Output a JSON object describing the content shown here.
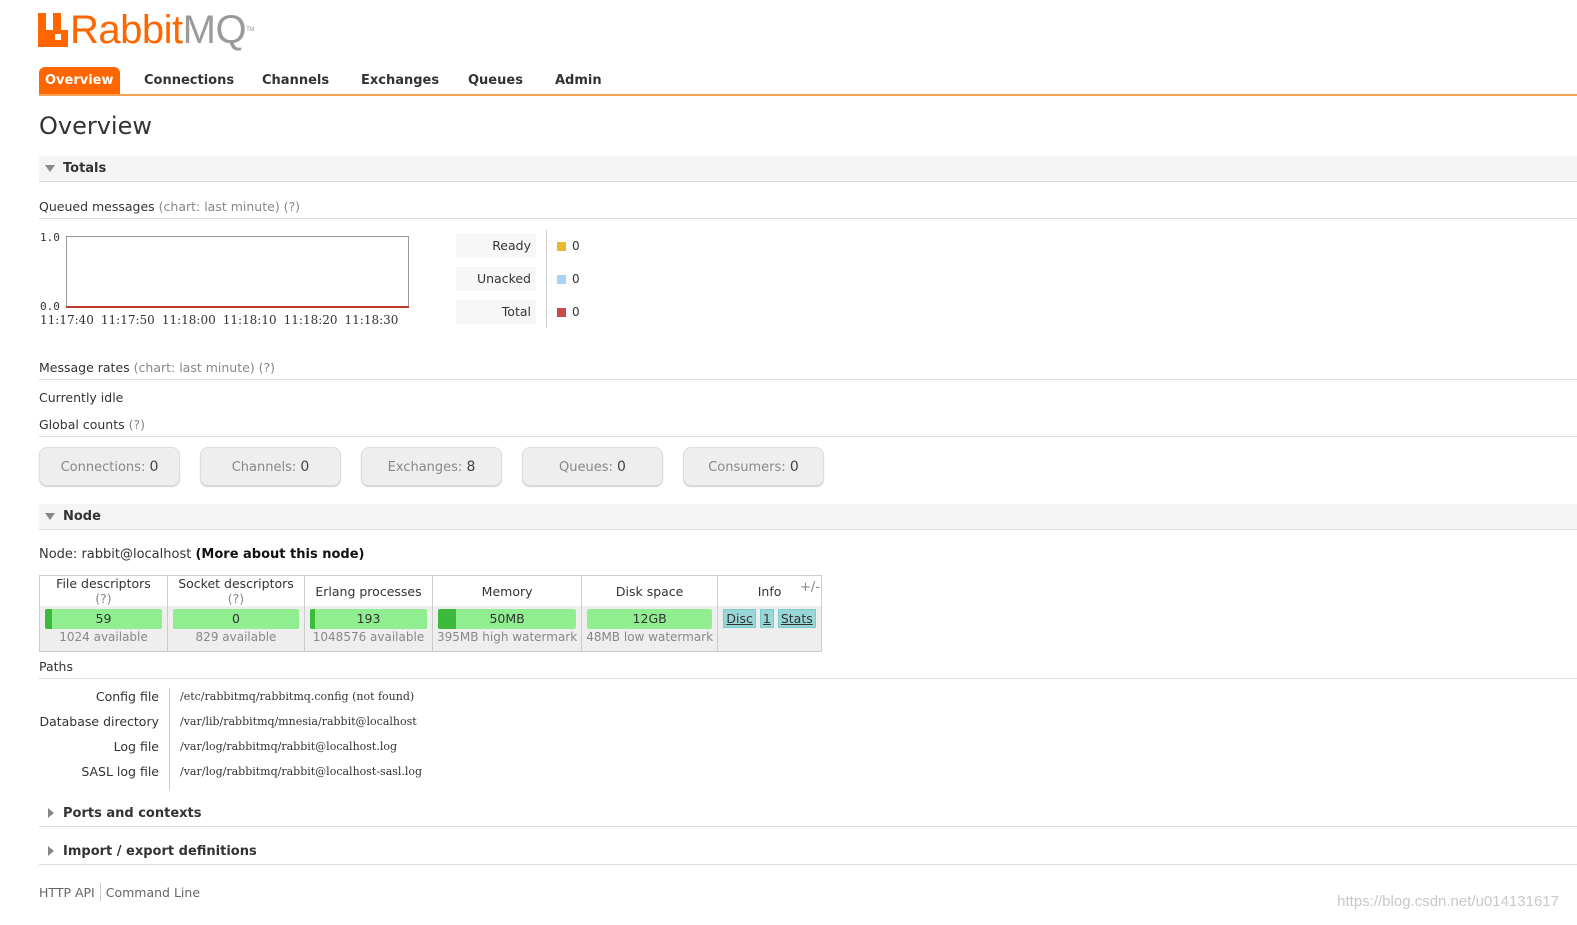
{
  "brand": {
    "rabbit": "Rabbit",
    "mq": "MQ",
    "tm": "TM"
  },
  "nav": {
    "overview": "Overview",
    "connections": "Connections",
    "channels": "Channels",
    "exchanges": "Exchanges",
    "queues": "Queues",
    "admin": "Admin"
  },
  "page_title": "Overview",
  "totals": {
    "header": "Totals",
    "queued_label": "Queued messages",
    "queued_help": "(chart: last minute) (?)",
    "y_max": "1.0",
    "y_min": "0.0",
    "x_ticks": [
      "11:17:40",
      "11:17:50",
      "11:18:00",
      "11:18:10",
      "11:18:20",
      "11:18:30"
    ],
    "legend": [
      {
        "label": "Ready",
        "value": "0",
        "color": "#e8b931"
      },
      {
        "label": "Unacked",
        "value": "0",
        "color": "#a8d3f5"
      },
      {
        "label": "Total",
        "value": "0",
        "color": "#c94a4a"
      }
    ],
    "rates_label": "Message rates",
    "rates_help": "(chart: last minute) (?)",
    "idle_text": "Currently idle",
    "global_label": "Global counts",
    "global_help": "(?)",
    "counts": {
      "connections_label": "Connections:",
      "connections_value": "0",
      "channels_label": "Channels:",
      "channels_value": "0",
      "exchanges_label": "Exchanges:",
      "exchanges_value": "8",
      "queues_label": "Queues:",
      "queues_value": "0",
      "consumers_label": "Consumers:",
      "consumers_value": "0"
    }
  },
  "node": {
    "header": "Node",
    "node_label": "Node: rabbit@localhost",
    "more_link": "(More about this node)",
    "columns": {
      "file": "File descriptors",
      "file_help": "(?)",
      "socket": "Socket descriptors",
      "socket_help": "(?)",
      "erlang": "Erlang processes",
      "memory": "Memory",
      "disk": "Disk space",
      "info": "Info"
    },
    "values": {
      "file": "59",
      "file_avail": "1024 available",
      "file_fraction": 0.058,
      "socket": "0",
      "socket_avail": "829 available",
      "socket_fraction": 0,
      "erlang": "193",
      "erlang_avail": "1048576 available",
      "erlang_fraction": 0.0002,
      "memory": "50MB",
      "memory_avail": "395MB high watermark",
      "memory_fraction": 0.127,
      "disk": "12GB",
      "disk_avail": "48MB low watermark",
      "disk_fraction": 0
    },
    "info_tags": {
      "disc": "Disc",
      "one": "1",
      "stats": "Stats"
    },
    "plusminus": "+/-"
  },
  "paths": {
    "label": "Paths",
    "rows": [
      {
        "key": "Config file",
        "value": "/etc/rabbitmq/rabbitmq.config (not found)"
      },
      {
        "key": "Database directory",
        "value": "/var/lib/rabbitmq/mnesia/rabbit@localhost"
      },
      {
        "key": "Log file",
        "value": "/var/log/rabbitmq/rabbit@localhost.log"
      },
      {
        "key": "SASL log file",
        "value": "/var/log/rabbitmq/rabbit@localhost-sasl.log"
      }
    ]
  },
  "ports_header": "Ports and contexts",
  "import_header": "Import / export definitions",
  "footer": {
    "http_api": "HTTP API",
    "command_line": "Command Line"
  },
  "watermark": "https://blog.csdn.net/u014131617",
  "colors": {
    "accent": "#ff6600",
    "bar": "#90ee90",
    "bar_fill": "#3cba3c"
  }
}
